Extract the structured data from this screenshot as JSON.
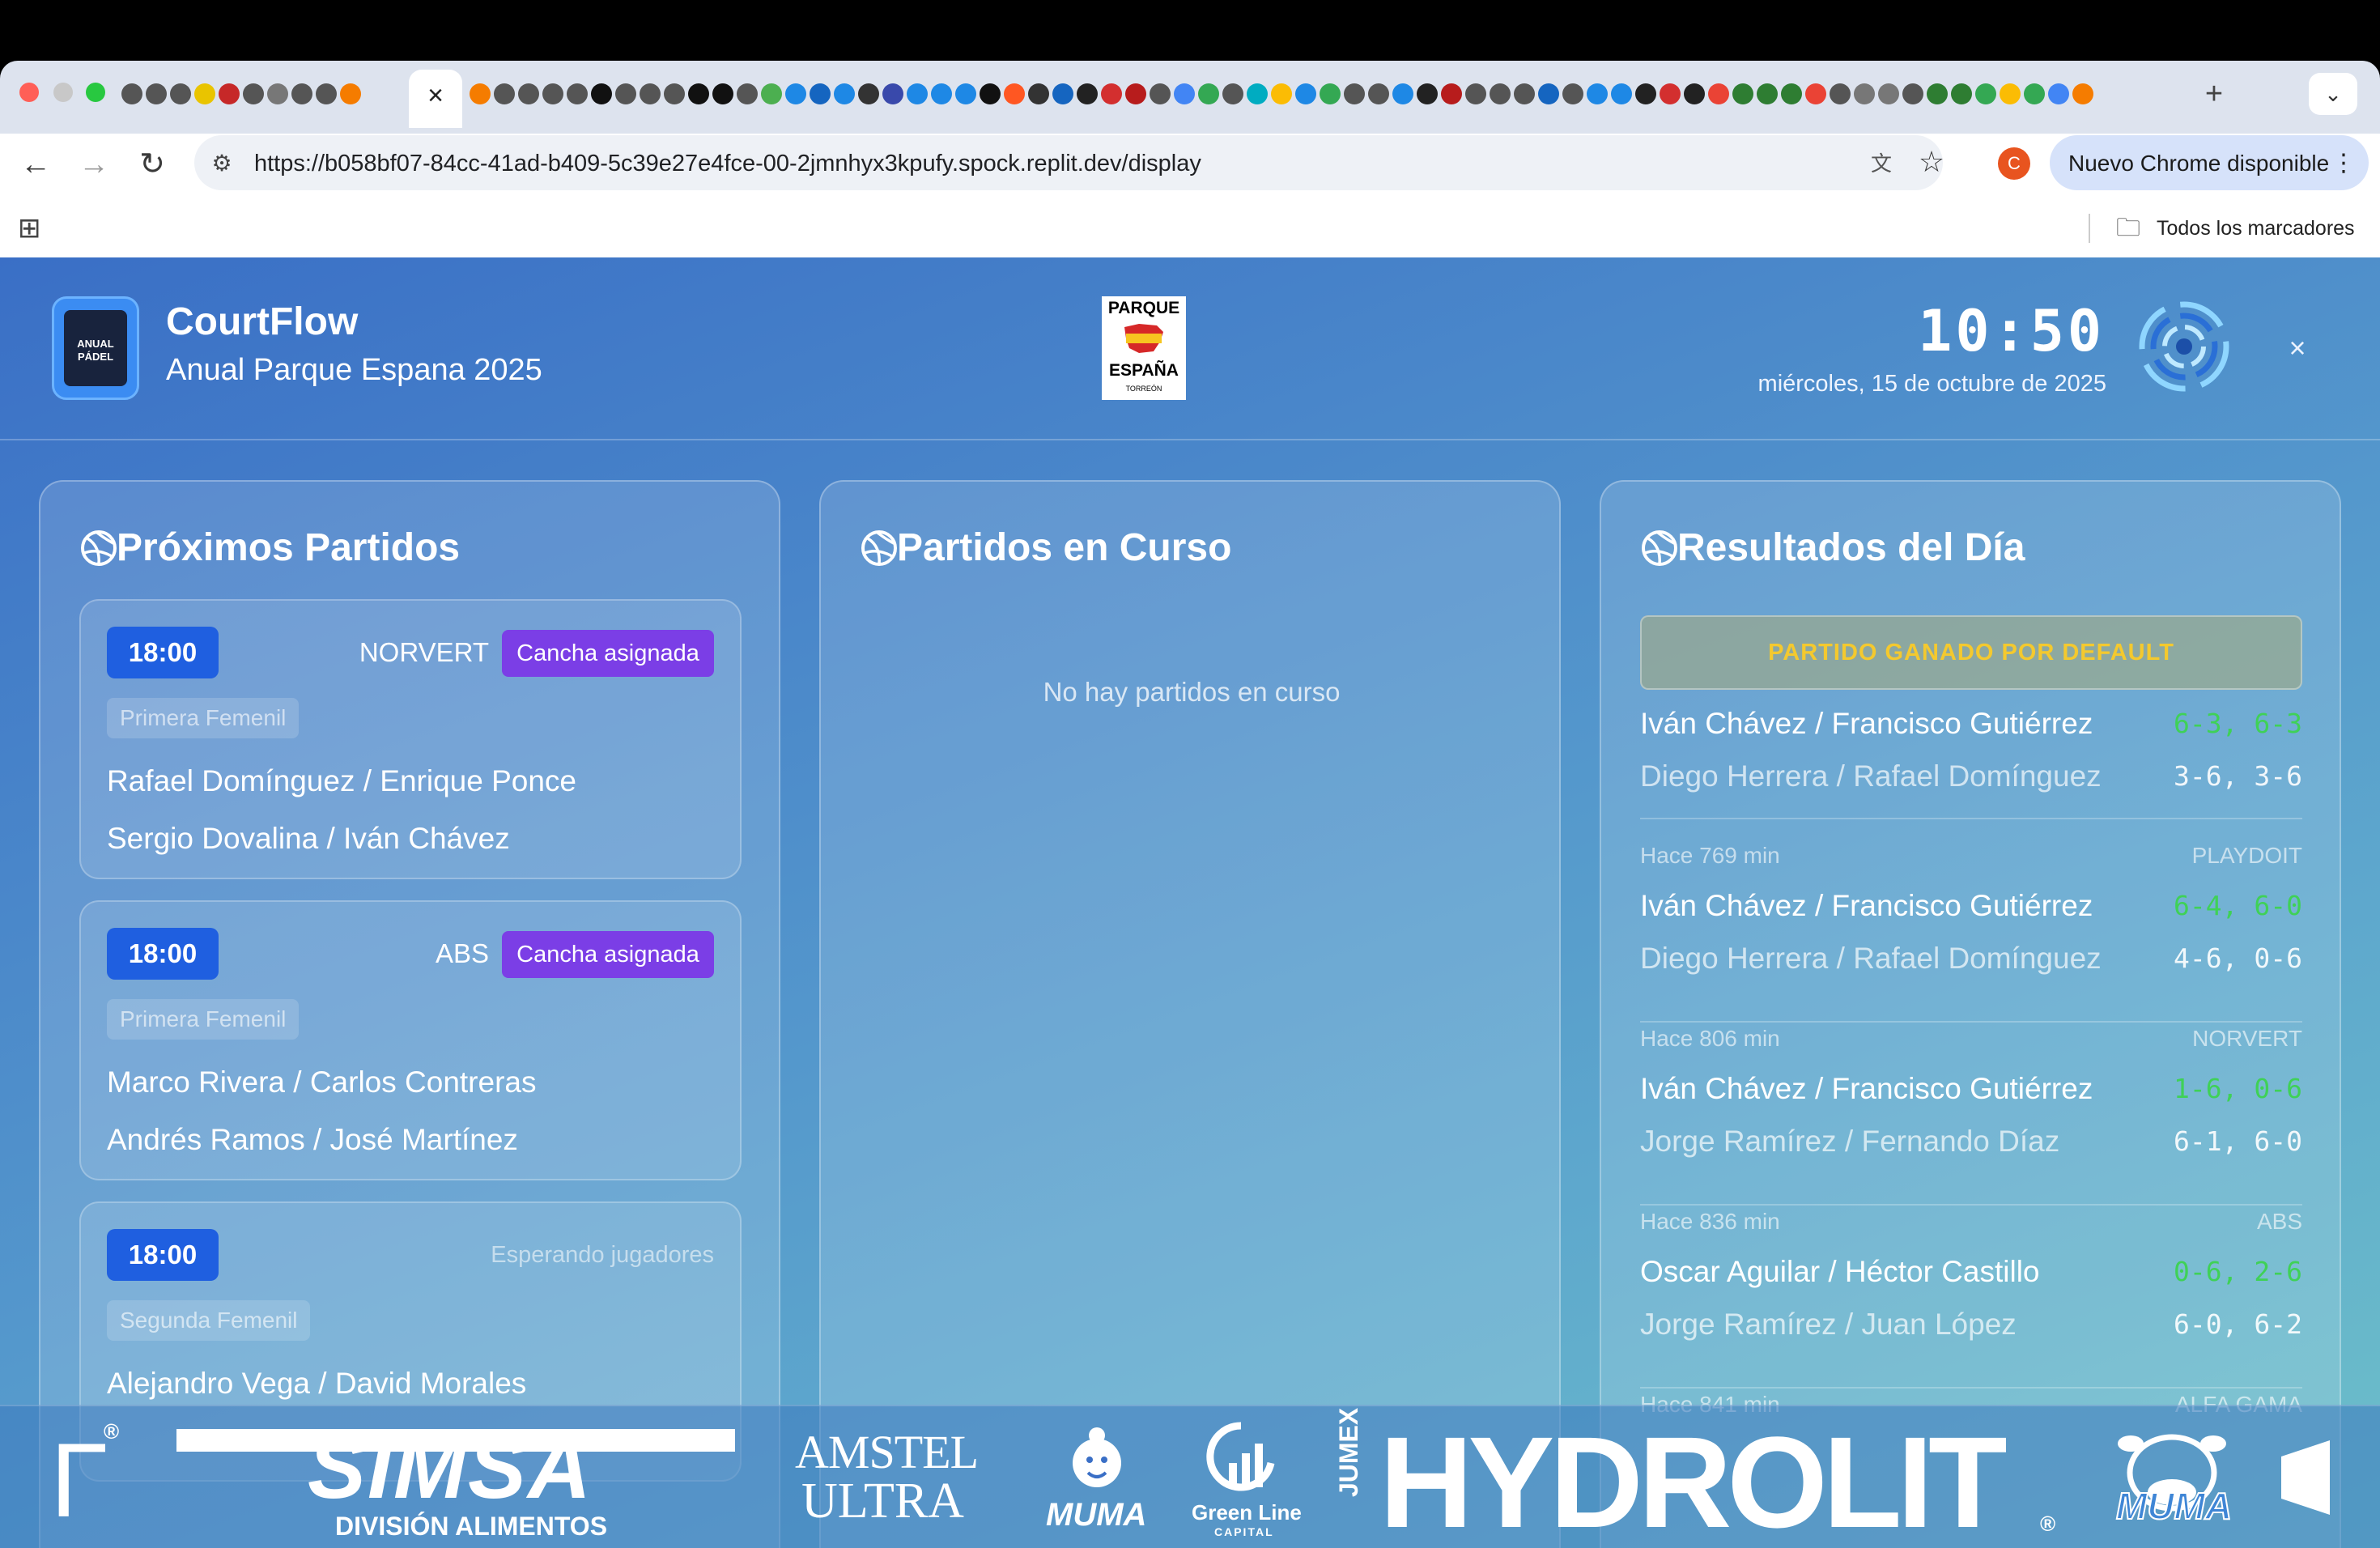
{
  "browser": {
    "url": "https://b058bf07-84cc-41ad-b409-5c39e27e4fce-00-2jmnhyx3kpufy.spock.replit.dev/display",
    "tab_close_glyph": "×",
    "new_tab_glyph": "+",
    "tab_menu_glyph": "⌄",
    "profile_initial": "C",
    "update_label": "Nuevo Chrome disponible",
    "update_menu_glyph": "⋮",
    "bookmarks_label": "Todos los marcadores",
    "icons": {
      "back": "←",
      "forward": "→",
      "reload": "↻",
      "site_info": "⚙",
      "translate": "文",
      "star": "☆",
      "apps": "⊞",
      "folder": "🗀"
    }
  },
  "app": {
    "name": "CourtFlow",
    "tournament": "Anual Parque Espana 2025",
    "logo_text": "ANUAL PÁDEL",
    "club_logo": {
      "top": "PARQUE",
      "bottom": "ESPAÑA",
      "sub": "TORREÓN"
    },
    "clock": "10:50",
    "date": "miércoles, 15 de octubre de 2025",
    "close_glyph": "×"
  },
  "colors": {
    "accent_blue": "#1f5fe0",
    "court_pill": "#7b3ee6",
    "win_score": "#3fd157",
    "default_banner_text": "#f4c92e"
  },
  "upcoming": {
    "title": "Próximos Partidos",
    "matches": [
      {
        "time": "18:00",
        "court": "NORVERT",
        "status": "Cancha asignada",
        "category": "Primera Femenil",
        "team1": "Rafael Domínguez / Enrique Ponce",
        "team2": "Sergio Dovalina / Iván Chávez"
      },
      {
        "time": "18:00",
        "court": "ABS",
        "status": "Cancha asignada",
        "category": "Primera Femenil",
        "team1": "Marco Rivera / Carlos Contreras",
        "team2": "Andrés Ramos / José Martínez"
      },
      {
        "time": "18:00",
        "court": "",
        "status": "Esperando jugadores",
        "category": "Segunda Femenil",
        "team1": "Alejandro Vega / David Morales",
        "team2": ""
      }
    ]
  },
  "inplay": {
    "title": "Partidos en Curso",
    "empty": "No hay partidos en curso"
  },
  "results": {
    "title": "Resultados del Día",
    "default_banner": "PARTIDO GANADO POR DEFAULT",
    "items": [
      {
        "ago": "",
        "court": "",
        "winner": "Iván Chávez / Francisco Gutiérrez",
        "winner_score": "6-3, 6-3",
        "loser": "Diego Herrera / Rafael Domínguez",
        "loser_score": "3-6, 3-6"
      },
      {
        "ago": "Hace 769 min",
        "court": "PLAYDOIT",
        "winner": "Iván Chávez / Francisco Gutiérrez",
        "winner_score": "6-4, 6-0",
        "loser": "Diego Herrera / Rafael Domínguez",
        "loser_score": "4-6, 0-6"
      },
      {
        "ago": "Hace 806 min",
        "court": "NORVERT",
        "winner": "Iván Chávez / Francisco Gutiérrez",
        "winner_score": "1-6, 0-6",
        "loser": "Jorge Ramírez / Fernando Díaz",
        "loser_score": "6-1, 6-0"
      },
      {
        "ago": "Hace 836 min",
        "court": "ABS",
        "winner": "Oscar Aguilar / Héctor Castillo",
        "winner_score": "0-6, 2-6",
        "loser": "Jorge Ramírez / Juan López",
        "loser_score": "6-0, 6-2"
      },
      {
        "ago": "Hace 841 min",
        "court": "ALFA GAMA",
        "winner": "",
        "winner_score": "",
        "loser": "",
        "loser_score": ""
      }
    ]
  },
  "sponsors": {
    "bracket": "Γ",
    "simsa": "SIMSA",
    "simsa_sub": "DIVISIÓN ALIMENTOS",
    "amstel_1": "AMSTEL",
    "amstel_2": "ULTRA",
    "muma": "MUMA",
    "greenline": "Green Line",
    "greenline_sub": "CAPITAL",
    "jumex": "JUMEX",
    "hydrolit": "HYDROLIT",
    "muma2": "MUMA",
    "registered": "®"
  }
}
